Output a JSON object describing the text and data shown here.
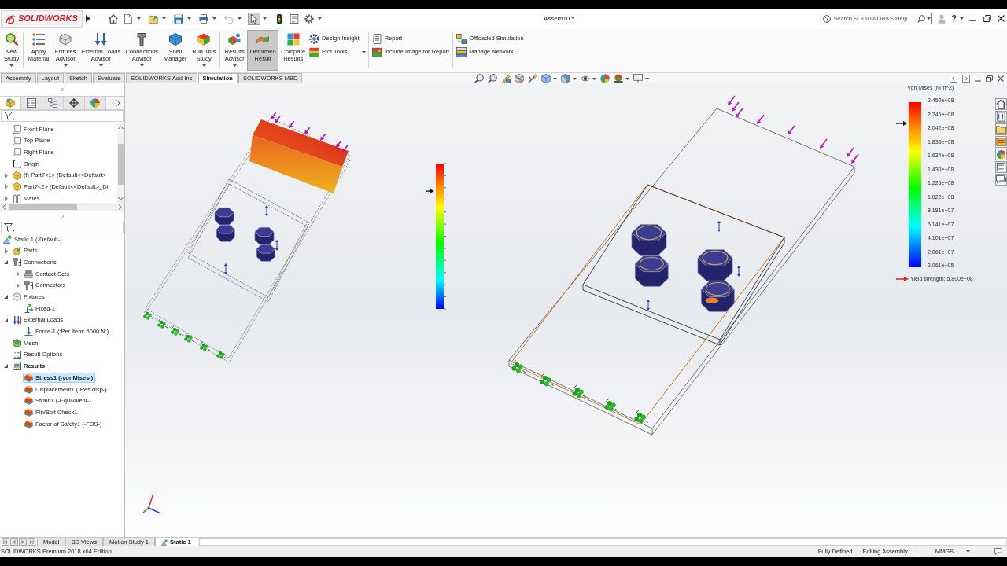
{
  "window": {
    "brand": "SOLIDWORKS",
    "title": "Assem10 *",
    "search": {
      "placeholder": "Search SOLIDWORKS Help"
    },
    "help": "?"
  },
  "quick_access": [
    {
      "disabled": false,
      "selected": false
    },
    {
      "dropdown": true,
      "disabled": false,
      "selected": false
    },
    {
      "dropdown": true,
      "disabled": false,
      "selected": false
    },
    {
      "dropdown": true,
      "disabled": false,
      "selected": false
    },
    {
      "dropdown": true,
      "disabled": false,
      "selected": false
    },
    {
      "dropdown": true,
      "disabled": true,
      "selected": false
    },
    {
      "dropdown": true,
      "disabled": false,
      "selected": true
    },
    {
      "disabled": false,
      "selected": false
    },
    {
      "disabled": false,
      "selected": false
    },
    {
      "dropdown": true,
      "disabled": false,
      "selected": false
    }
  ],
  "ribbon": {
    "groups": [
      [
        {
          "kind": "large",
          "label": [
            "New",
            "Study"
          ],
          "dropdown": true,
          "selected": false
        }
      ],
      [
        {
          "kind": "large",
          "label": [
            "Apply",
            "Material"
          ],
          "selected": false
        },
        {
          "kind": "large",
          "label": [
            "Fixtures",
            "Advisor"
          ],
          "dropdown": true,
          "selected": false
        },
        {
          "kind": "large",
          "label": [
            "External Loads",
            "Advisor"
          ],
          "dropdown": true,
          "selected": false
        },
        {
          "kind": "large",
          "label": [
            "Connections",
            "Advisor"
          ],
          "dropdown": true,
          "selected": false
        },
        {
          "kind": "large",
          "label": [
            "Shell",
            "Manager"
          ],
          "selected": false
        },
        {
          "kind": "large",
          "label": [
            "Run This",
            "Study"
          ],
          "dropdown": true,
          "selected": false
        }
      ],
      [
        {
          "kind": "large",
          "label": [
            "Results",
            "Advisor"
          ],
          "dropdown": true,
          "selected": false
        },
        {
          "kind": "large",
          "label": [
            "Deformed",
            "Result"
          ],
          "selected": true
        },
        {
          "kind": "large",
          "label": [
            "Compare",
            "Results"
          ],
          "selected": false
        },
        {
          "kind": "stack",
          "items": [
            {
              "label": "Design Insight"
            },
            {
              "label": "Plot Tools"
            }
          ],
          "dropdown": true
        }
      ],
      [
        {
          "kind": "stack",
          "items": [
            {
              "label": "Report"
            },
            {
              "label": "Include Image for Report"
            }
          ]
        }
      ],
      [
        {
          "kind": "stack",
          "items": [
            {
              "label": "Offloaded Simulation"
            },
            {
              "label": "Manage Network"
            }
          ]
        }
      ]
    ]
  },
  "command_tabs": [
    {
      "label": "Assembly",
      "selected": false
    },
    {
      "label": "Layout",
      "selected": false
    },
    {
      "label": "Sketch",
      "selected": false
    },
    {
      "label": "Evaluate",
      "selected": false
    },
    {
      "label": "SOLIDWORKS Add-Ins",
      "selected": false
    },
    {
      "label": "Simulation",
      "selected": true
    },
    {
      "label": "SOLIDWORKS MBD",
      "selected": false
    }
  ],
  "feature_panel": {
    "tabs": [
      {
        "selected": true
      },
      {
        "selected": false
      },
      {
        "selected": false
      },
      {
        "selected": false
      },
      {
        "selected": false
      }
    ],
    "tree": [
      {
        "label": "Front Plane",
        "kind": "plane",
        "selected": false
      },
      {
        "label": "Top Plane",
        "kind": "plane",
        "selected": false
      },
      {
        "label": "Right Plane",
        "kind": "plane",
        "selected": false
      },
      {
        "label": "Origin",
        "kind": "origin",
        "selected": false
      },
      {
        "label": "(f) Part7<1> (Default<<Default>_",
        "kind": "part",
        "expanded": false,
        "selected": false
      },
      {
        "label": "Part7<2> (Default<<Default>_Di",
        "kind": "part",
        "expanded": false,
        "selected": false
      },
      {
        "label": "Mates",
        "kind": "mates",
        "expanded": false,
        "selected": false
      }
    ]
  },
  "study_tree": [
    {
      "label": "Static 1 (-Default-)",
      "kind": "study",
      "selected": false,
      "children": [
        {
          "label": "Parts",
          "kind": "parts",
          "expanded": false,
          "selected": false
        },
        {
          "label": "Connections",
          "kind": "connections",
          "expanded": true,
          "selected": false,
          "children": [
            {
              "label": "Contact Sets",
              "kind": "contact-sets",
              "expanded": false,
              "selected": false
            },
            {
              "label": "Connectors",
              "kind": "connectors",
              "expanded": false,
              "selected": false
            }
          ]
        },
        {
          "label": "Fixtures",
          "kind": "fixtures",
          "expanded": true,
          "selected": false,
          "children": [
            {
              "label": "Fixed-1",
              "kind": "fixture",
              "selected": false
            }
          ]
        },
        {
          "label": "External Loads",
          "kind": "loads",
          "expanded": true,
          "selected": false,
          "children": [
            {
              "label": "Force-1 (:Per item: 5000 N:)",
              "kind": "force",
              "selected": false
            }
          ]
        },
        {
          "label": "Mesh",
          "kind": "mesh",
          "selected": false
        },
        {
          "label": "Result Options",
          "kind": "result-options",
          "selected": false
        },
        {
          "label": "Results",
          "kind": "results",
          "expanded": true,
          "selected": false,
          "bold": true,
          "children": [
            {
              "label": "Stress1 (-vonMises-)",
              "kind": "plot",
              "selected": true,
              "bold": true
            },
            {
              "label": "Displacement1 (-Res disp-)",
              "kind": "plot",
              "selected": false
            },
            {
              "label": "Strain1 (-Equivalent-)",
              "kind": "plot",
              "selected": false
            },
            {
              "label": "Pin/Bolt Check1",
              "kind": "plot",
              "selected": false
            },
            {
              "label": "Factor of Safety1 (-FOS-)",
              "kind": "plot",
              "selected": false
            }
          ]
        }
      ]
    }
  ],
  "graphics": {
    "left_legend": {
      "pointer": {
        "level": 0.81
      }
    },
    "legend": {
      "title": "von Mises (N/m^2)",
      "labels": [
        "2.450e+08",
        "2.246e+08",
        "2.042e+08",
        "1.838e+08",
        "1.634e+08",
        "1.430e+08",
        "1.226e+08",
        "1.022e+08",
        "8.181e+07",
        "6.141e+07",
        "4.101e+07",
        "2.061e+07",
        "2.061e+05"
      ],
      "pointer": {
        "level": 0.87
      },
      "yield_strength": "Yield strength: 5.800e+08"
    }
  },
  "bottom_tabs": [
    {
      "label": "Model",
      "kind": "model",
      "selected": false
    },
    {
      "label": "3D Views",
      "kind": "views",
      "selected": false
    },
    {
      "label": "Motion Study 1",
      "kind": "motion",
      "selected": false
    },
    {
      "label": "Static 1",
      "kind": "study",
      "selected": true
    }
  ],
  "status_bar": {
    "edition": "SOLIDWORKS Premium 2018 x64 Edition",
    "state": "Fully Defined",
    "mode": "Editing Assembly",
    "units": "MMGS"
  }
}
